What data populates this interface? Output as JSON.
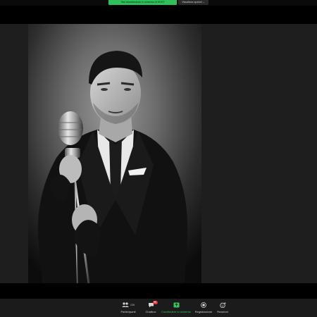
{
  "top_bar": {
    "share_banner": "Stai visualizzando lo schermo di HOST",
    "view_options": "Visualizza opzioni ⌄"
  },
  "toolbar": {
    "participants": {
      "label": "Partecipanti",
      "count": "126"
    },
    "chat": {
      "label": "Chatbox",
      "badge": "99"
    },
    "share_screen": {
      "label": "Condividere lo schermo"
    },
    "record": {
      "label": "Registrazione"
    },
    "reactions": {
      "label": "Reazioni"
    }
  },
  "colors": {
    "share_green": "#2ec05a",
    "toolbar_bg": "#1b1b1b",
    "badge_red": "#e0303a"
  }
}
